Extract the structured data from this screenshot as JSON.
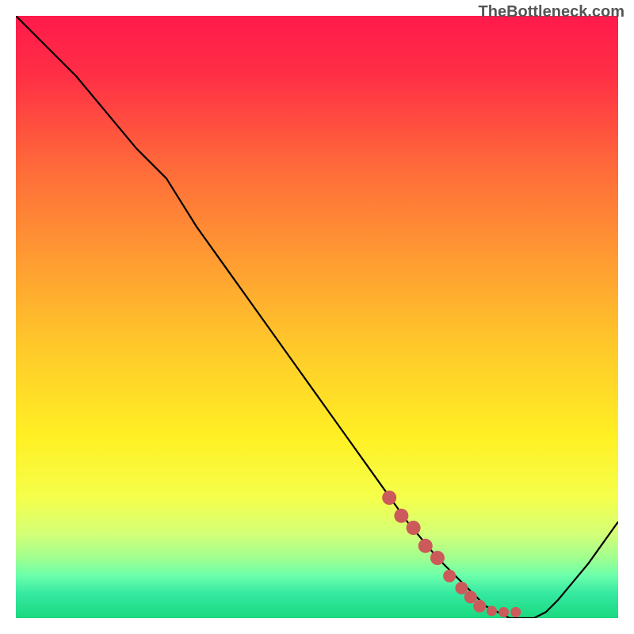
{
  "watermark": "TheBottleneck.com",
  "chart_data": {
    "type": "line",
    "title": "",
    "xlabel": "",
    "ylabel": "",
    "xlim": [
      0,
      100
    ],
    "ylim": [
      0,
      100
    ],
    "series": [
      {
        "name": "bottleneck-curve",
        "x": [
          0,
          5,
          10,
          15,
          20,
          25,
          30,
          35,
          40,
          45,
          50,
          55,
          60,
          65,
          70,
          75,
          78,
          80,
          82,
          84,
          86,
          88,
          90,
          95,
          100
        ],
        "y": [
          100,
          95,
          90,
          84,
          78,
          73,
          65,
          58,
          51,
          44,
          37,
          30,
          23,
          16,
          10,
          5,
          2,
          1,
          0,
          0,
          0,
          1,
          3,
          9,
          16
        ]
      },
      {
        "name": "highlight-dots",
        "x": [
          62,
          64,
          66,
          68,
          70,
          72,
          74,
          75.5,
          77,
          79,
          81,
          83
        ],
        "y": [
          20,
          17,
          15,
          12,
          10,
          7,
          5,
          3.5,
          2,
          1.2,
          1,
          1
        ]
      }
    ],
    "gradient_stops": [
      {
        "offset": 0.0,
        "color": "#ff1a4b"
      },
      {
        "offset": 0.1,
        "color": "#ff2f45"
      },
      {
        "offset": 0.25,
        "color": "#ff6a3a"
      },
      {
        "offset": 0.4,
        "color": "#ff9a32"
      },
      {
        "offset": 0.55,
        "color": "#ffc92a"
      },
      {
        "offset": 0.7,
        "color": "#fff024"
      },
      {
        "offset": 0.8,
        "color": "#f5ff4b"
      },
      {
        "offset": 0.86,
        "color": "#d4ff77"
      },
      {
        "offset": 0.9,
        "color": "#a0ff8f"
      },
      {
        "offset": 0.93,
        "color": "#6affab"
      },
      {
        "offset": 0.96,
        "color": "#34e8a0"
      },
      {
        "offset": 1.0,
        "color": "#1bd97f"
      }
    ],
    "curve_color": "#000000",
    "dot_color": "#cc5a5a"
  }
}
